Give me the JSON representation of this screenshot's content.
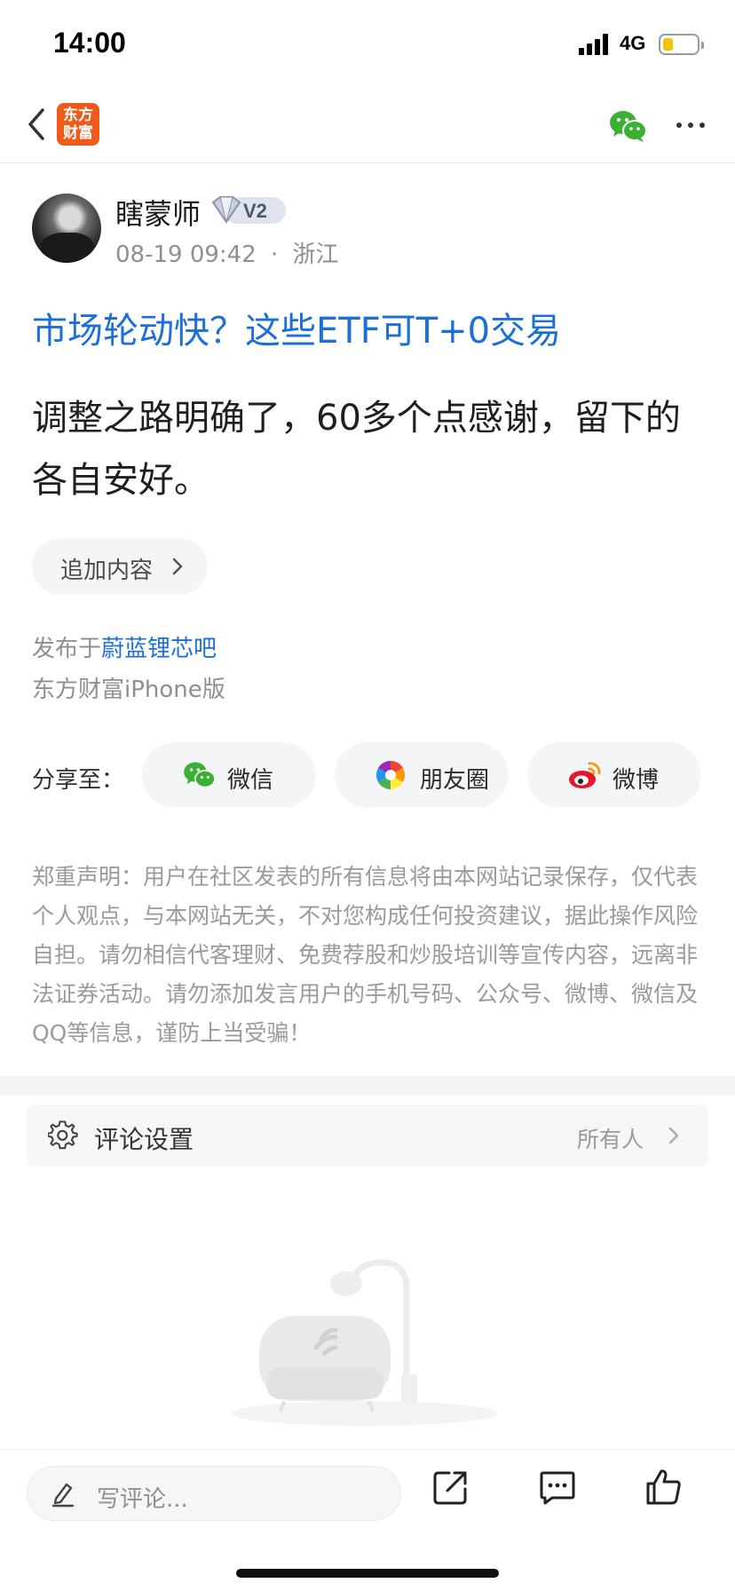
{
  "status_bar": {
    "time": "14:00",
    "network": "4G",
    "battery_level": 0.3,
    "battery_color": "#f5c400"
  },
  "nav": {
    "back_icon": "chevron-left-icon",
    "logo_text_line1": "东方",
    "logo_text_line2": "财富",
    "logo_color": "#ef5a1a",
    "share_icon": "wechat-icon",
    "more_icon": "more-dots-icon"
  },
  "author": {
    "name": "瞎蒙师",
    "badge": "V2",
    "date": "08-19 09:42",
    "separator": "·",
    "location": "浙江"
  },
  "post": {
    "title": "市场轮动快？这些ETF可T+0交易",
    "body": "调整之路明确了，60多个点感谢，留下的各自安好。",
    "append_label": "追加内容",
    "publish_prefix": "发布于",
    "publish_forum": "蔚蓝锂芯吧",
    "client": "东方财富iPhone版"
  },
  "share": {
    "label": "分享至：",
    "items": [
      {
        "label": "微信",
        "icon": "wechat-icon"
      },
      {
        "label": "朋友圈",
        "icon": "moments-icon"
      },
      {
        "label": "微博",
        "icon": "weibo-icon"
      }
    ]
  },
  "disclaimer": "郑重声明：用户在社区发表的所有信息将由本网站记录保存，仅代表个人观点，与本网站无关，不对您构成任何投资建议，据此操作风险自担。请勿相信代客理财、免费荐股和炒股培训等宣传内容，远离非法证券活动。请勿添加发言用户的手机号码、公众号、微博、微信及QQ等信息，谨防上当受骗！",
  "comment_settings": {
    "label": "评论设置",
    "value": "所有人",
    "icon": "gear-icon"
  },
  "bottom_bar": {
    "comment_placeholder": "写评论...",
    "icons": [
      "share-out-icon",
      "comment-icon",
      "like-icon"
    ]
  },
  "colors": {
    "link_blue": "#1c6fd6",
    "wechat_green": "#3cb034",
    "weibo_red": "#e6162d"
  }
}
